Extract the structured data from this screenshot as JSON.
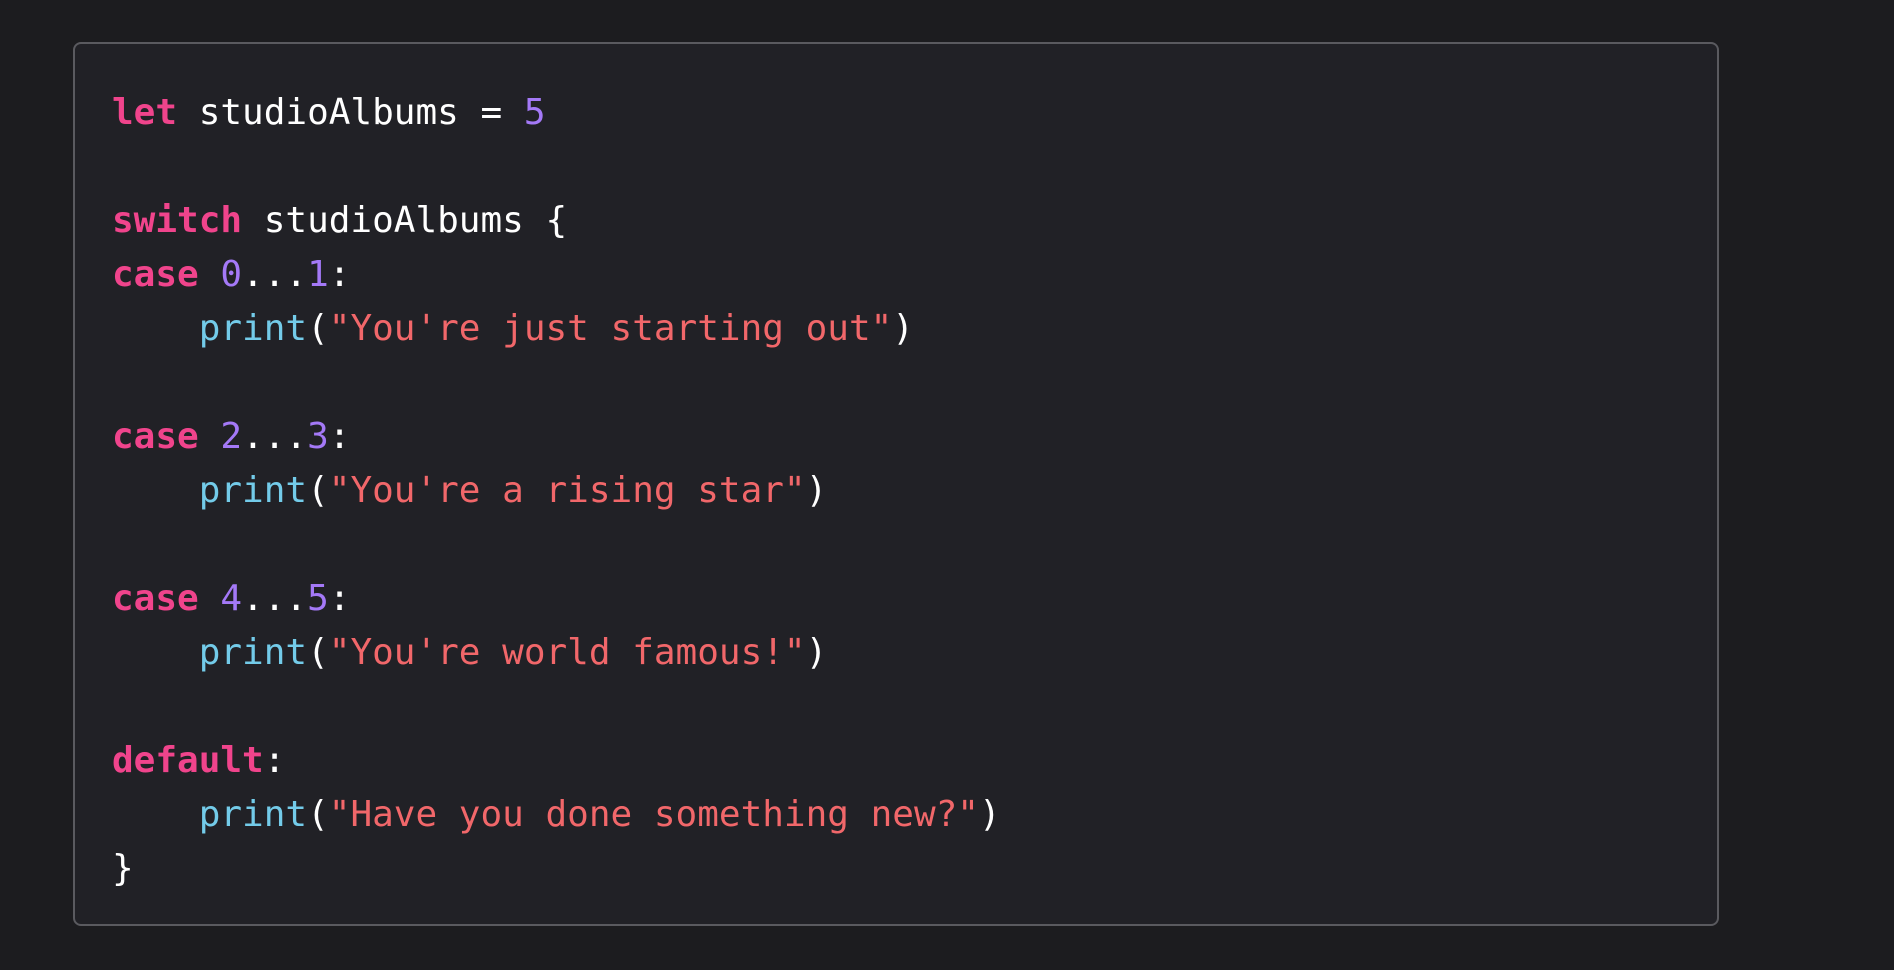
{
  "code": {
    "language": "swift",
    "lines": [
      [
        {
          "t": "kw",
          "v": "let"
        },
        {
          "t": "plain",
          "v": " studioAlbums = "
        },
        {
          "t": "num",
          "v": "5"
        }
      ],
      [],
      [
        {
          "t": "kw",
          "v": "switch"
        },
        {
          "t": "plain",
          "v": " studioAlbums {"
        }
      ],
      [
        {
          "t": "kw",
          "v": "case"
        },
        {
          "t": "plain",
          "v": " "
        },
        {
          "t": "num",
          "v": "0"
        },
        {
          "t": "plain",
          "v": "..."
        },
        {
          "t": "num",
          "v": "1"
        },
        {
          "t": "plain",
          "v": ":"
        }
      ],
      [
        {
          "t": "plain",
          "v": "    "
        },
        {
          "t": "fn",
          "v": "print"
        },
        {
          "t": "plain",
          "v": "("
        },
        {
          "t": "str",
          "v": "\"You're just starting out\""
        },
        {
          "t": "plain",
          "v": ")"
        }
      ],
      [],
      [
        {
          "t": "kw",
          "v": "case"
        },
        {
          "t": "plain",
          "v": " "
        },
        {
          "t": "num",
          "v": "2"
        },
        {
          "t": "plain",
          "v": "..."
        },
        {
          "t": "num",
          "v": "3"
        },
        {
          "t": "plain",
          "v": ":"
        }
      ],
      [
        {
          "t": "plain",
          "v": "    "
        },
        {
          "t": "fn",
          "v": "print"
        },
        {
          "t": "plain",
          "v": "("
        },
        {
          "t": "str",
          "v": "\"You're a rising star\""
        },
        {
          "t": "plain",
          "v": ")"
        }
      ],
      [],
      [
        {
          "t": "kw",
          "v": "case"
        },
        {
          "t": "plain",
          "v": " "
        },
        {
          "t": "num",
          "v": "4"
        },
        {
          "t": "plain",
          "v": "..."
        },
        {
          "t": "num",
          "v": "5"
        },
        {
          "t": "plain",
          "v": ":"
        }
      ],
      [
        {
          "t": "plain",
          "v": "    "
        },
        {
          "t": "fn",
          "v": "print"
        },
        {
          "t": "plain",
          "v": "("
        },
        {
          "t": "str",
          "v": "\"You're world famous!\""
        },
        {
          "t": "plain",
          "v": ")"
        }
      ],
      [],
      [
        {
          "t": "kw",
          "v": "default"
        },
        {
          "t": "plain",
          "v": ":"
        }
      ],
      [
        {
          "t": "plain",
          "v": "    "
        },
        {
          "t": "fn",
          "v": "print"
        },
        {
          "t": "plain",
          "v": "("
        },
        {
          "t": "str",
          "v": "\"Have you done something new?\""
        },
        {
          "t": "plain",
          "v": ")"
        }
      ],
      [
        {
          "t": "plain",
          "v": "}"
        }
      ]
    ]
  },
  "colors": {
    "background": "#1c1c1f",
    "panel": "#212126",
    "border": "#5a5a5f",
    "keyword": "#f0448c",
    "number": "#a479f7",
    "function": "#73cbe9",
    "string": "#f1676a",
    "plain": "#ffffff"
  }
}
